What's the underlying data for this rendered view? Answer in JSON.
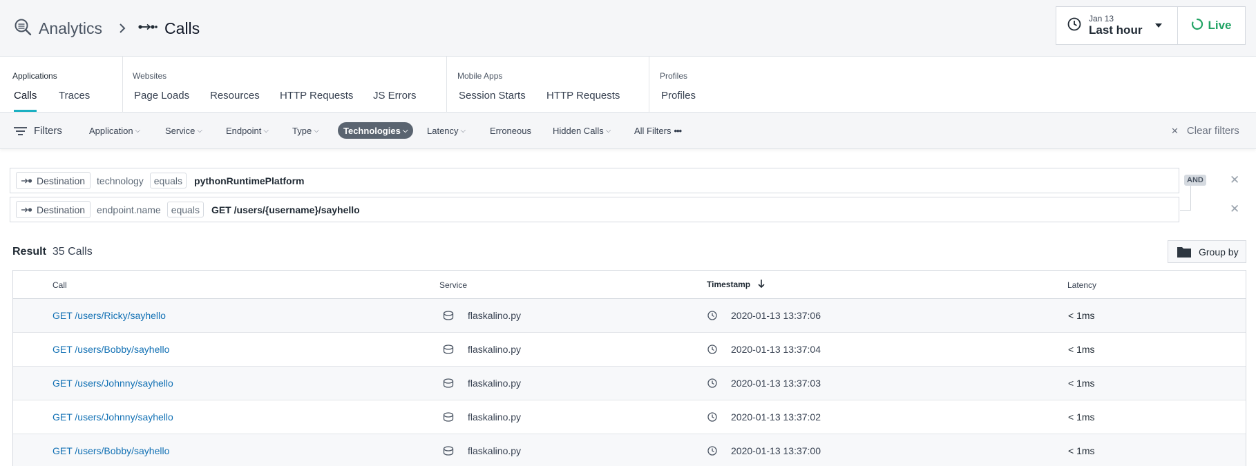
{
  "header": {
    "breadcrumb_root": "Analytics",
    "breadcrumb_current": "Calls",
    "time_date": "Jan 13",
    "time_range": "Last hour",
    "live_label": "Live"
  },
  "nav": {
    "groups": [
      {
        "title": "Applications",
        "tabs": [
          "Calls",
          "Traces"
        ]
      },
      {
        "title": "Websites",
        "tabs": [
          "Page Loads",
          "Resources",
          "HTTP Requests",
          "JS Errors"
        ]
      },
      {
        "title": "Mobile Apps",
        "tabs": [
          "Session Starts",
          "HTTP Requests"
        ]
      },
      {
        "title": "Profiles",
        "tabs": [
          "Profiles"
        ]
      }
    ],
    "active_tab": "Calls"
  },
  "filterbar": {
    "filters_label": "Filters",
    "items": [
      "Application",
      "Service",
      "Endpoint",
      "Type",
      "Technologies",
      "Latency",
      "Erroneous",
      "Hidden Calls",
      "All Filters"
    ],
    "active_item": "Technologies",
    "clear_label": "Clear filters"
  },
  "query": {
    "operator": "AND",
    "rows": [
      {
        "entity": "Destination",
        "key": "technology",
        "op": "equals",
        "value": "pythonRuntimePlatform"
      },
      {
        "entity": "Destination",
        "key": "endpoint.name",
        "op": "equals",
        "value": "GET /users/{username}/sayhello"
      }
    ]
  },
  "result": {
    "label": "Result",
    "count": "35 Calls",
    "group_by_label": "Group by"
  },
  "table": {
    "columns": [
      "Call",
      "Service",
      "Timestamp",
      "Latency"
    ],
    "sort_column": "Timestamp",
    "sort_direction": "desc",
    "rows": [
      {
        "call": "GET /users/Ricky/sayhello",
        "service": "flaskalino.py",
        "timestamp": "2020-01-13 13:37:06",
        "latency": "< 1ms"
      },
      {
        "call": "GET /users/Bobby/sayhello",
        "service": "flaskalino.py",
        "timestamp": "2020-01-13 13:37:04",
        "latency": "< 1ms"
      },
      {
        "call": "GET /users/Johnny/sayhello",
        "service": "flaskalino.py",
        "timestamp": "2020-01-13 13:37:03",
        "latency": "< 1ms"
      },
      {
        "call": "GET /users/Johnny/sayhello",
        "service": "flaskalino.py",
        "timestamp": "2020-01-13 13:37:02",
        "latency": "< 1ms"
      },
      {
        "call": "GET /users/Bobby/sayhello",
        "service": "flaskalino.py",
        "timestamp": "2020-01-13 13:37:00",
        "latency": "< 1ms"
      }
    ]
  },
  "colors": {
    "accent_teal": "#1bb0c2",
    "live_green": "#21a364",
    "link_blue": "#1170b4",
    "chip_active": "#5a6470"
  },
  "icons": {
    "analytics": "magnifier-chart-icon",
    "calls": "calls-dots-arrow-icon",
    "clock": "clock-icon",
    "live": "live-spinner-icon",
    "filters": "filter-lines-icon",
    "destination": "destination-arrow-icon",
    "folder": "folder-icon",
    "service": "database-icon"
  }
}
